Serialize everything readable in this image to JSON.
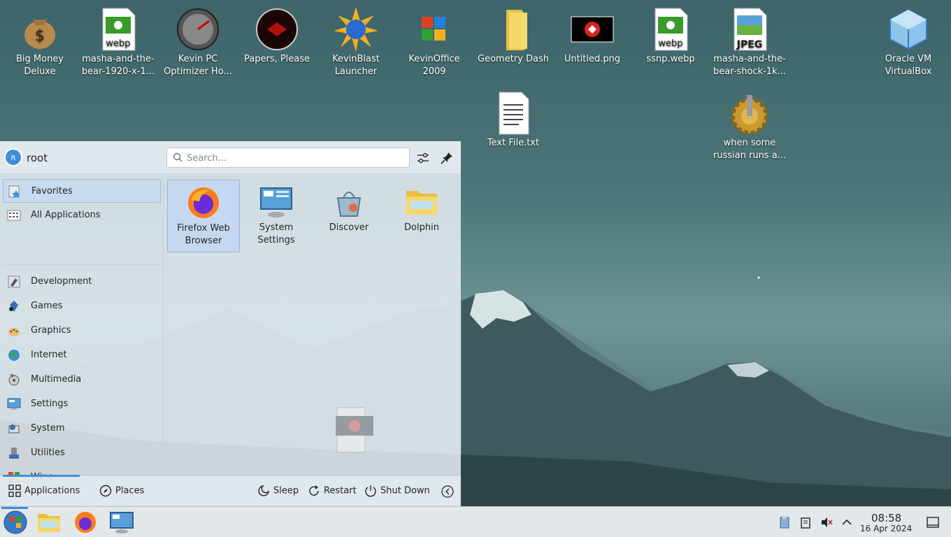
{
  "desktop": {
    "icons": [
      {
        "label": "Big Money Deluxe"
      },
      {
        "label": "masha-and-the-bear-1920-x-1..."
      },
      {
        "label": "Kevin PC Optimizer Ho..."
      },
      {
        "label": "Papers, Please"
      },
      {
        "label": "KevinBlast Launcher"
      },
      {
        "label": "KevinOffice 2009"
      },
      {
        "label": "Geometry Dash"
      },
      {
        "label": "Untitled.png"
      },
      {
        "label": "ssnp.webp"
      },
      {
        "label": "masha-and-the-bear-shock-1k..."
      },
      {
        "label": "Oracle VM VirtualBox"
      },
      {
        "label": "Text File.txt"
      },
      {
        "label": "when some russian runs a..."
      }
    ],
    "webp_badge": "webp",
    "jpeg_badge": "JPEG",
    "money_symbol": "$"
  },
  "launcher": {
    "user": {
      "name": "root",
      "avatar_letter": "R"
    },
    "search": {
      "placeholder": "Search..."
    },
    "sidebar": {
      "items": [
        {
          "label": "Favorites",
          "icon": "favorites-icon",
          "active": true
        },
        {
          "label": "All Applications",
          "icon": "all-apps-icon"
        },
        {
          "label": "Development",
          "icon": "development-icon"
        },
        {
          "label": "Games",
          "icon": "games-icon"
        },
        {
          "label": "Graphics",
          "icon": "graphics-icon"
        },
        {
          "label": "Internet",
          "icon": "internet-icon"
        },
        {
          "label": "Multimedia",
          "icon": "multimedia-icon"
        },
        {
          "label": "Settings",
          "icon": "settings-icon"
        },
        {
          "label": "System",
          "icon": "system-icon"
        },
        {
          "label": "Utilities",
          "icon": "utilities-icon"
        },
        {
          "label": "Wine",
          "icon": "wine-icon"
        }
      ]
    },
    "favorites": [
      {
        "label": "Firefox Web Browser",
        "active": true
      },
      {
        "label": "System Settings"
      },
      {
        "label": "Discover"
      },
      {
        "label": "Dolphin"
      }
    ],
    "footer": {
      "applications": "Applications",
      "places": "Places",
      "sleep": "Sleep",
      "restart": "Restart",
      "shutdown": "Shut Down"
    }
  },
  "taskbar": {
    "clock_time": "08:58",
    "clock_date": "16 Apr 2024"
  },
  "colors": {
    "accent": "#3d8fd8",
    "panel": "#e2e7ea"
  }
}
